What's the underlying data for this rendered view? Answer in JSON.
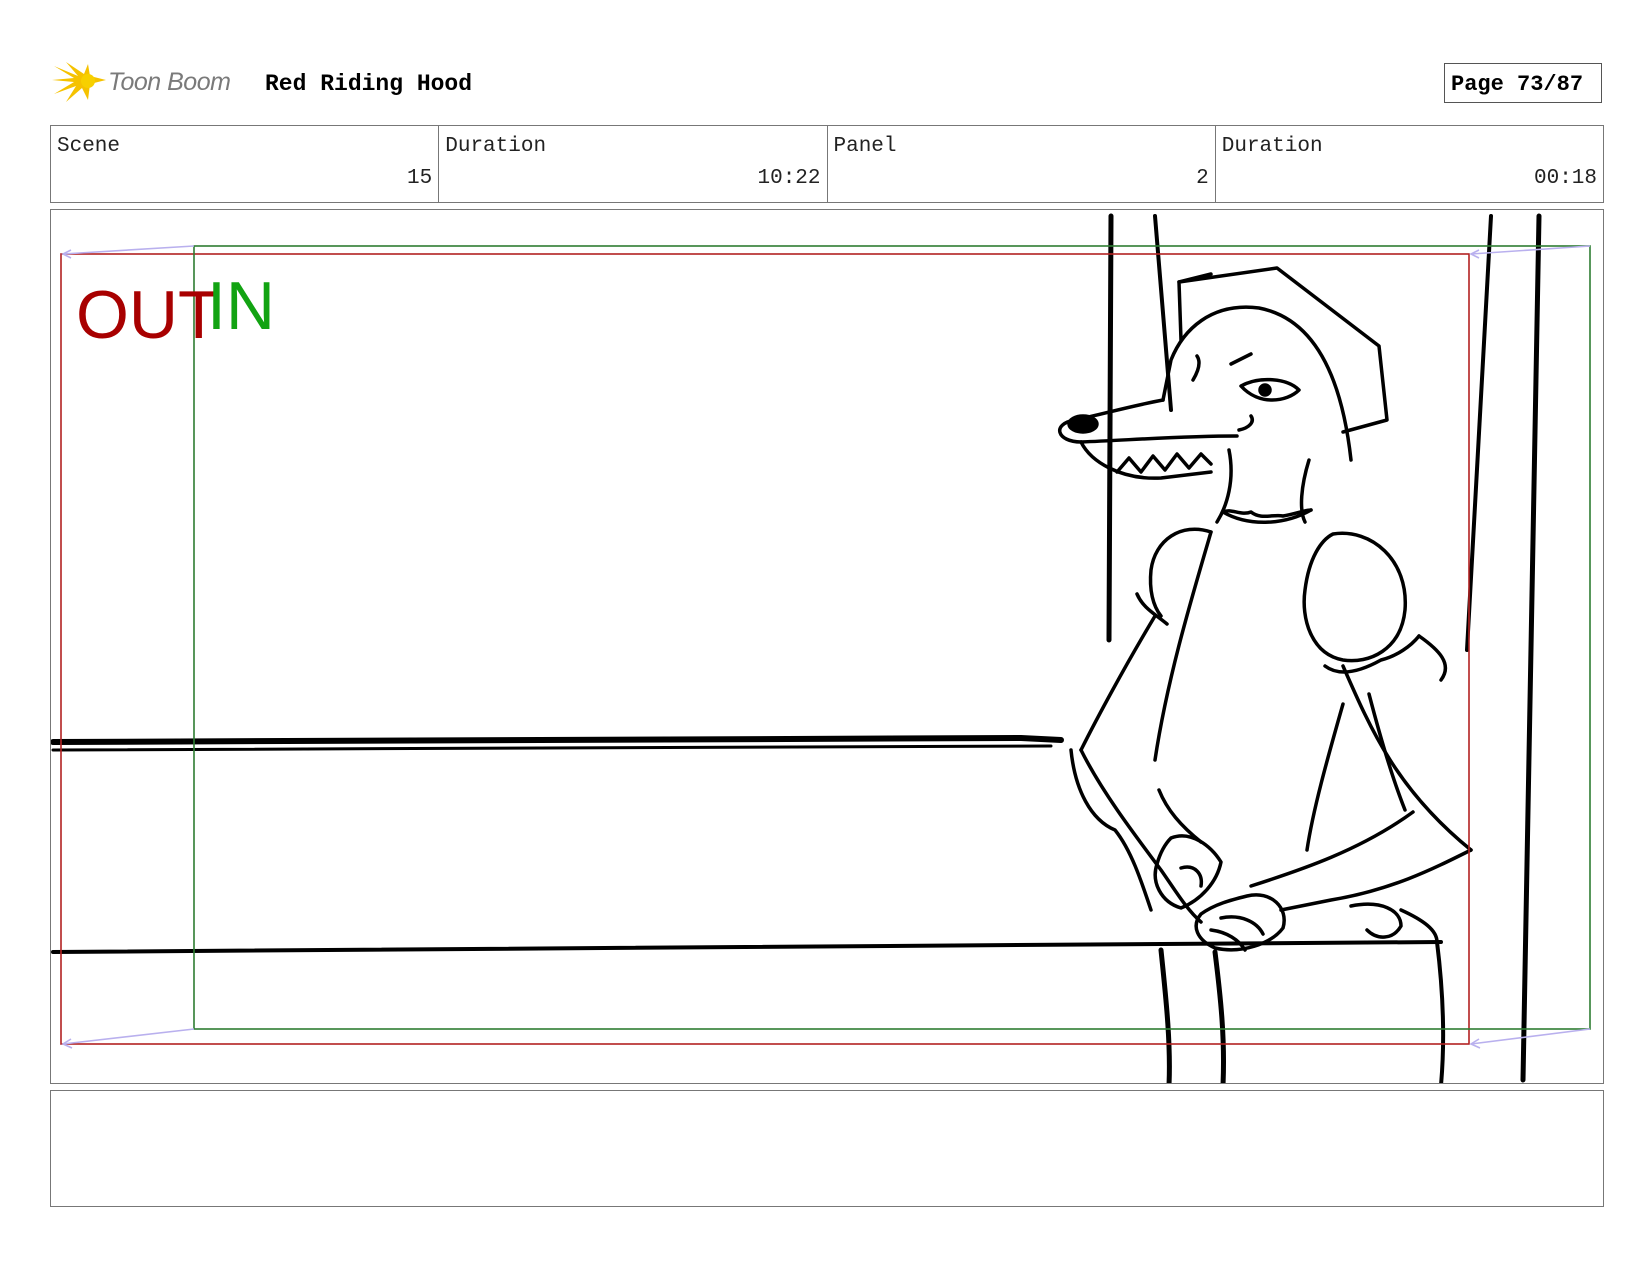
{
  "header": {
    "logo_text": "Toon Boom",
    "project_title": "Red Riding Hood",
    "page_label": "Page 73/87"
  },
  "info": {
    "cells": [
      {
        "label": "Scene",
        "value": "15"
      },
      {
        "label": "Duration",
        "value": "10:22"
      },
      {
        "label": "Panel",
        "value": "2"
      },
      {
        "label": "Duration",
        "value": "00:18"
      }
    ]
  },
  "panel": {
    "out_label": "OUT",
    "in_label": "IN",
    "colors": {
      "out_frame": "#b22222",
      "in_frame": "#2e7d32",
      "camera_arrow": "#b9b0ee",
      "sketch": "#000000"
    },
    "drawing_description": "wolf-in-bonnet-leaning-on-fence"
  },
  "notes": {
    "text": ""
  }
}
